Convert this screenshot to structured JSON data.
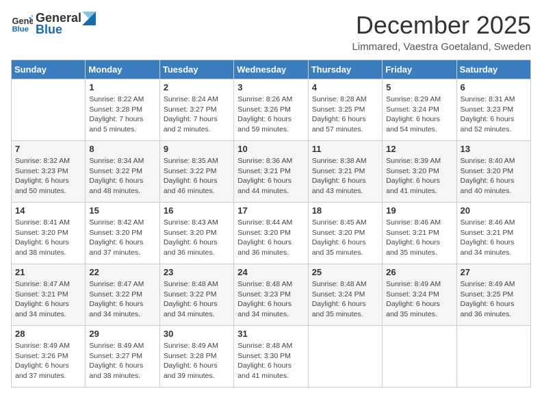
{
  "header": {
    "logo_general": "General",
    "logo_blue": "Blue",
    "title": "December 2025",
    "subtitle": "Limmared, Vaestra Goetaland, Sweden"
  },
  "days_of_week": [
    "Sunday",
    "Monday",
    "Tuesday",
    "Wednesday",
    "Thursday",
    "Friday",
    "Saturday"
  ],
  "weeks": [
    [
      {
        "day": "",
        "info": ""
      },
      {
        "day": "1",
        "info": "Sunrise: 8:22 AM\nSunset: 3:28 PM\nDaylight: 7 hours\nand 5 minutes."
      },
      {
        "day": "2",
        "info": "Sunrise: 8:24 AM\nSunset: 3:27 PM\nDaylight: 7 hours\nand 2 minutes."
      },
      {
        "day": "3",
        "info": "Sunrise: 8:26 AM\nSunset: 3:26 PM\nDaylight: 6 hours\nand 59 minutes."
      },
      {
        "day": "4",
        "info": "Sunrise: 8:28 AM\nSunset: 3:25 PM\nDaylight: 6 hours\nand 57 minutes."
      },
      {
        "day": "5",
        "info": "Sunrise: 8:29 AM\nSunset: 3:24 PM\nDaylight: 6 hours\nand 54 minutes."
      },
      {
        "day": "6",
        "info": "Sunrise: 8:31 AM\nSunset: 3:23 PM\nDaylight: 6 hours\nand 52 minutes."
      }
    ],
    [
      {
        "day": "7",
        "info": "Sunrise: 8:32 AM\nSunset: 3:23 PM\nDaylight: 6 hours\nand 50 minutes."
      },
      {
        "day": "8",
        "info": "Sunrise: 8:34 AM\nSunset: 3:22 PM\nDaylight: 6 hours\nand 48 minutes."
      },
      {
        "day": "9",
        "info": "Sunrise: 8:35 AM\nSunset: 3:22 PM\nDaylight: 6 hours\nand 46 minutes."
      },
      {
        "day": "10",
        "info": "Sunrise: 8:36 AM\nSunset: 3:21 PM\nDaylight: 6 hours\nand 44 minutes."
      },
      {
        "day": "11",
        "info": "Sunrise: 8:38 AM\nSunset: 3:21 PM\nDaylight: 6 hours\nand 43 minutes."
      },
      {
        "day": "12",
        "info": "Sunrise: 8:39 AM\nSunset: 3:20 PM\nDaylight: 6 hours\nand 41 minutes."
      },
      {
        "day": "13",
        "info": "Sunrise: 8:40 AM\nSunset: 3:20 PM\nDaylight: 6 hours\nand 40 minutes."
      }
    ],
    [
      {
        "day": "14",
        "info": "Sunrise: 8:41 AM\nSunset: 3:20 PM\nDaylight: 6 hours\nand 38 minutes."
      },
      {
        "day": "15",
        "info": "Sunrise: 8:42 AM\nSunset: 3:20 PM\nDaylight: 6 hours\nand 37 minutes."
      },
      {
        "day": "16",
        "info": "Sunrise: 8:43 AM\nSunset: 3:20 PM\nDaylight: 6 hours\nand 36 minutes."
      },
      {
        "day": "17",
        "info": "Sunrise: 8:44 AM\nSunset: 3:20 PM\nDaylight: 6 hours\nand 36 minutes."
      },
      {
        "day": "18",
        "info": "Sunrise: 8:45 AM\nSunset: 3:20 PM\nDaylight: 6 hours\nand 35 minutes."
      },
      {
        "day": "19",
        "info": "Sunrise: 8:46 AM\nSunset: 3:21 PM\nDaylight: 6 hours\nand 35 minutes."
      },
      {
        "day": "20",
        "info": "Sunrise: 8:46 AM\nSunset: 3:21 PM\nDaylight: 6 hours\nand 34 minutes."
      }
    ],
    [
      {
        "day": "21",
        "info": "Sunrise: 8:47 AM\nSunset: 3:21 PM\nDaylight: 6 hours\nand 34 minutes."
      },
      {
        "day": "22",
        "info": "Sunrise: 8:47 AM\nSunset: 3:22 PM\nDaylight: 6 hours\nand 34 minutes."
      },
      {
        "day": "23",
        "info": "Sunrise: 8:48 AM\nSunset: 3:22 PM\nDaylight: 6 hours\nand 34 minutes."
      },
      {
        "day": "24",
        "info": "Sunrise: 8:48 AM\nSunset: 3:23 PM\nDaylight: 6 hours\nand 34 minutes."
      },
      {
        "day": "25",
        "info": "Sunrise: 8:48 AM\nSunset: 3:24 PM\nDaylight: 6 hours\nand 35 minutes."
      },
      {
        "day": "26",
        "info": "Sunrise: 8:49 AM\nSunset: 3:24 PM\nDaylight: 6 hours\nand 35 minutes."
      },
      {
        "day": "27",
        "info": "Sunrise: 8:49 AM\nSunset: 3:25 PM\nDaylight: 6 hours\nand 36 minutes."
      }
    ],
    [
      {
        "day": "28",
        "info": "Sunrise: 8:49 AM\nSunset: 3:26 PM\nDaylight: 6 hours\nand 37 minutes."
      },
      {
        "day": "29",
        "info": "Sunrise: 8:49 AM\nSunset: 3:27 PM\nDaylight: 6 hours\nand 38 minutes."
      },
      {
        "day": "30",
        "info": "Sunrise: 8:49 AM\nSunset: 3:28 PM\nDaylight: 6 hours\nand 39 minutes."
      },
      {
        "day": "31",
        "info": "Sunrise: 8:48 AM\nSunset: 3:30 PM\nDaylight: 6 hours\nand 41 minutes."
      },
      {
        "day": "",
        "info": ""
      },
      {
        "day": "",
        "info": ""
      },
      {
        "day": "",
        "info": ""
      }
    ]
  ]
}
